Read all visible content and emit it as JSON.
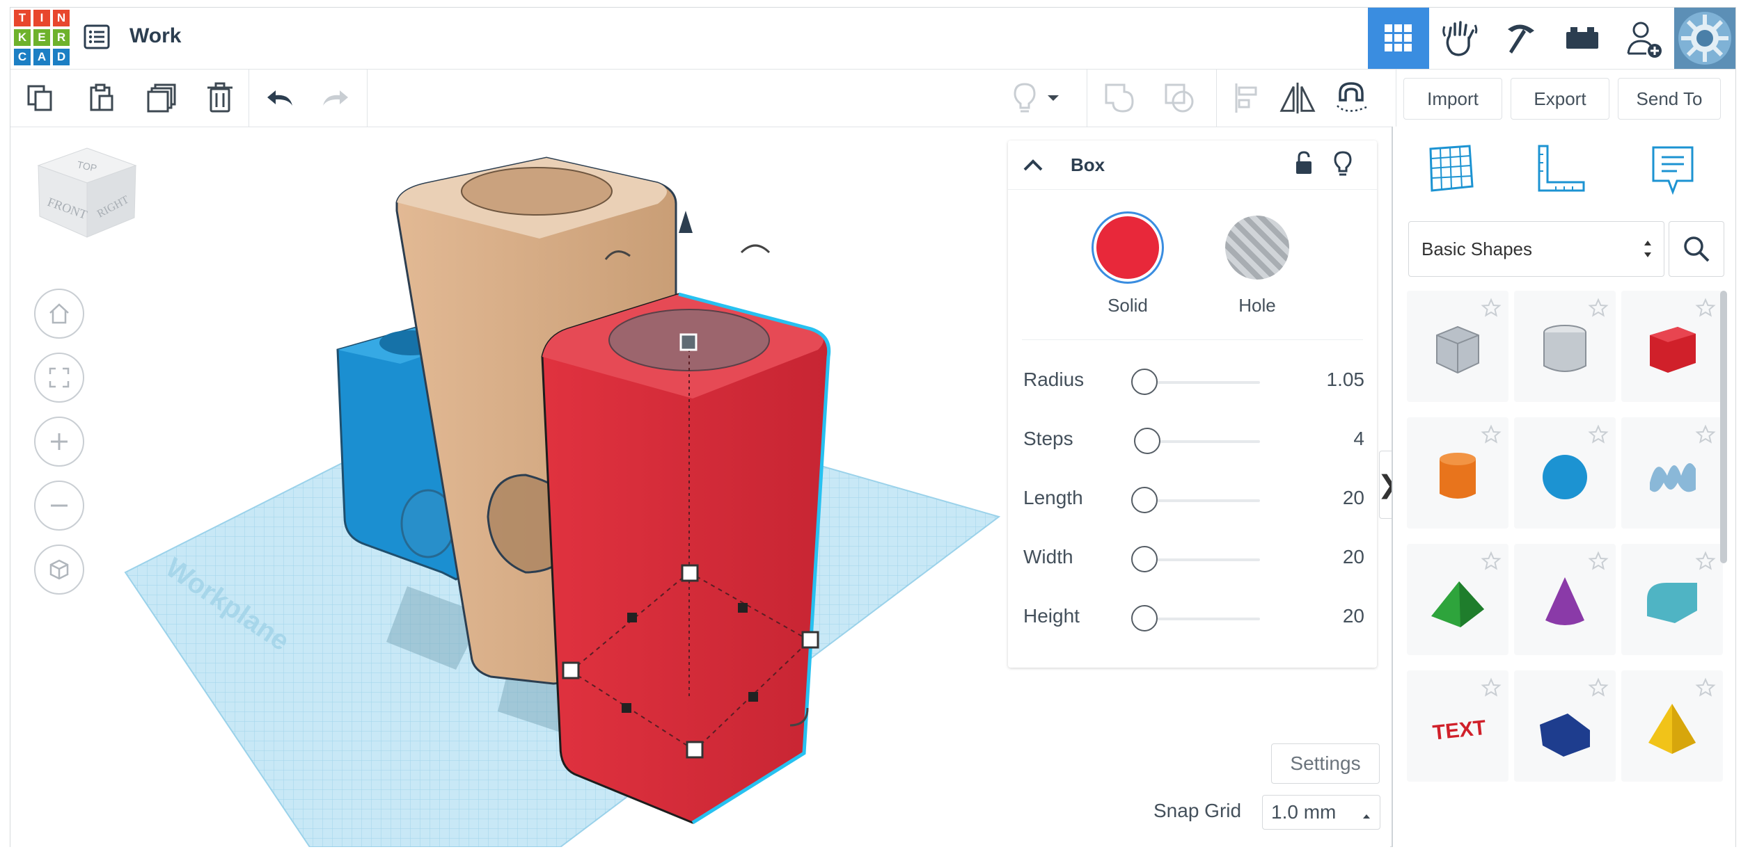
{
  "app": {
    "logo_letters": [
      "T",
      "I",
      "N",
      "K",
      "E",
      "R",
      "C",
      "A",
      "D"
    ],
    "logo_colors": [
      "#e8472d",
      "#e8472d",
      "#e8472d",
      "#6eb22c",
      "#6eb22c",
      "#6eb22c",
      "#1c7fc4",
      "#1c7fc4",
      "#1c7fc4"
    ],
    "design_name": "Work"
  },
  "header_icons": [
    {
      "icon": "grid-3d-view-icon",
      "active": true
    },
    {
      "icon": "sim-lab-hand-icon",
      "active": false
    },
    {
      "icon": "pickaxe-minecraft-icon",
      "active": false
    },
    {
      "icon": "brick-lego-icon",
      "active": false
    },
    {
      "icon": "add-user-icon",
      "active": false
    },
    {
      "icon": "profile-avatar-icon",
      "active": false
    }
  ],
  "toolbar": {
    "copy_icon": "copy-icon",
    "paste_icon": "paste-icon",
    "duplicate_icon": "duplicate-icon",
    "delete_icon": "trash-icon",
    "undo_icon": "undo-icon",
    "redo_icon": "redo-icon",
    "import_label": "Import",
    "export_label": "Export",
    "send_to_label": "Send To"
  },
  "viewcube": {
    "top": "TOP",
    "front": "FRONT",
    "right": "RIGHT"
  },
  "workplane_label": "Workplane",
  "inspector": {
    "title": "Box",
    "solid_label": "Solid",
    "hole_label": "Hole",
    "solid_color": "#e8283a",
    "properties": [
      {
        "label": "Radius",
        "value": "1.05",
        "fraction": 0.0
      },
      {
        "label": "Steps",
        "value": "4",
        "fraction": 0.1
      },
      {
        "label": "Length",
        "value": "20",
        "fraction": 0.08
      },
      {
        "label": "Width",
        "value": "20",
        "fraction": 0.08
      },
      {
        "label": "Height",
        "value": "20",
        "fraction": 0.08
      }
    ]
  },
  "settings_label": "Settings",
  "snap_grid": {
    "label": "Snap Grid",
    "value": "1.0 mm"
  },
  "shapes_panel": {
    "category": "Basic Shapes",
    "shapes": [
      {
        "name": "box-hole",
        "color": "#b9c0c8"
      },
      {
        "name": "cylinder-hole",
        "color": "#c3c9cf"
      },
      {
        "name": "box",
        "color": "#d0202a"
      },
      {
        "name": "cylinder",
        "color": "#e8741c"
      },
      {
        "name": "sphere",
        "color": "#1c93d2"
      },
      {
        "name": "scribble",
        "color": "#8ab8d8"
      },
      {
        "name": "roof",
        "color": "#2ea43c"
      },
      {
        "name": "cone",
        "color": "#8a3aa8"
      },
      {
        "name": "round-roof",
        "color": "#4fb4c4"
      },
      {
        "name": "text",
        "color": "#d0202a"
      },
      {
        "name": "wedge",
        "color": "#1e3d8e"
      },
      {
        "name": "pyramid",
        "color": "#f1c319"
      }
    ]
  }
}
